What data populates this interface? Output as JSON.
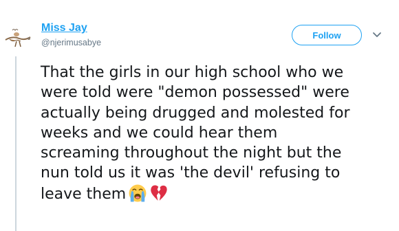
{
  "tweet": {
    "author": {
      "display_name": "Miss Jay",
      "handle": "@njerimusabye"
    },
    "follow_label": "Follow",
    "text_lines": [
      "That the girls in our high school who we",
      "were told were \"demon possessed\" were",
      "actually being drugged and molested for",
      "weeks and we could hear them",
      "screaming throughout the night but the",
      "nun told us it was 'the devil' refusing to",
      "leave them"
    ],
    "emojis": [
      "loudly-crying-face-icon",
      "broken-heart-icon"
    ]
  },
  "colors": {
    "accent": "#1da1f2",
    "text": "#14171a",
    "secondary_text": "#657786",
    "thread_line": "#ccd6dd",
    "broken_heart": "#dd2e44",
    "emoji_face": "#ffcc4d",
    "tears": "#5dadec"
  }
}
